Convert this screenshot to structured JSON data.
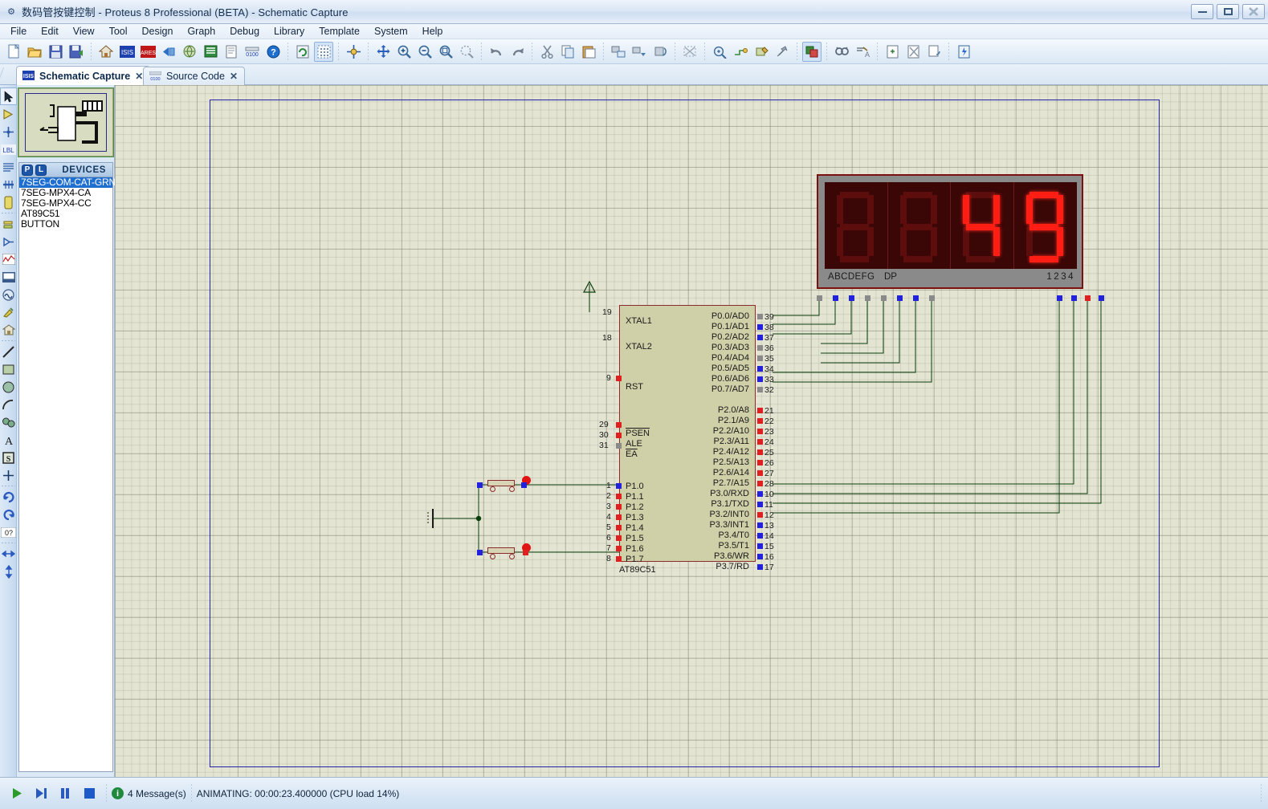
{
  "window": {
    "title": "数码管按键控制 - Proteus 8 Professional (BETA) - Schematic Capture",
    "minimize_label": "—",
    "maximize_label": "❐",
    "close_label": "✕",
    "sysicon_name": "proteus-app-icon"
  },
  "menu": {
    "items": [
      {
        "label": "File"
      },
      {
        "label": "Edit"
      },
      {
        "label": "View"
      },
      {
        "label": "Tool"
      },
      {
        "label": "Design"
      },
      {
        "label": "Graph"
      },
      {
        "label": "Debug"
      },
      {
        "label": "Library"
      },
      {
        "label": "Template"
      },
      {
        "label": "System"
      },
      {
        "label": "Help"
      }
    ]
  },
  "toolbar": {
    "groups": [
      [
        "new-icon",
        "open-icon",
        "save-icon",
        "save-as-icon"
      ],
      [
        "home-icon",
        "isis-icon",
        "ares-icon",
        "back-icon",
        "3d-view-icon",
        "bom-icon",
        "report-icon",
        "source-code-icon",
        "help-icon"
      ],
      [
        "refresh-icon",
        "grid-toggle-icon"
      ],
      [
        "origin-icon"
      ],
      [
        "pan-icon",
        "zoom-in-icon",
        "zoom-out-icon",
        "zoom-all-icon",
        "zoom-area-icon"
      ],
      [
        "undo-icon",
        "redo-icon"
      ],
      [
        "cut-icon",
        "copy-icon",
        "paste-icon"
      ],
      [
        "block-copy-icon",
        "block-move-icon",
        "block-rotate-icon",
        "block-delete-icon"
      ],
      [
        "pick-device-icon",
        "make-device-icon",
        "packaging-tool-icon",
        "decompose-icon"
      ],
      [
        "wire-autorouter-icon"
      ],
      [
        "search-tag-icon",
        "property-assign-icon"
      ],
      [
        "new-sheet-icon",
        "remove-sheet-icon",
        "exit-sheet-icon"
      ],
      [
        "bill-icon"
      ]
    ]
  },
  "tabs": [
    {
      "label": "Schematic Capture",
      "icon": "isis-tab-icon",
      "active": true,
      "close": "✕"
    },
    {
      "label": "Source Code",
      "icon": "code-tab-icon",
      "active": false,
      "close": "✕"
    }
  ],
  "left_toolbar": {
    "tools": [
      {
        "name": "selection-mode-icon",
        "glyph": "➤",
        "selected": true
      },
      {
        "name": "component-mode-icon",
        "glyph": "▷"
      },
      {
        "name": "junction-dot-mode-icon",
        "glyph": "✛"
      },
      {
        "name": "wire-label-mode-icon",
        "glyph": "LBL"
      },
      {
        "name": "text-script-mode-icon",
        "glyph": "≡"
      },
      {
        "name": "bus-mode-icon",
        "glyph": "╫"
      },
      {
        "name": "subcircuit-mode-icon",
        "glyph": "▯"
      },
      {
        "name": "terminals-mode-icon",
        "glyph": "⊐"
      },
      {
        "name": "device-pin-mode-icon",
        "glyph": "⇒"
      },
      {
        "name": "graph-mode-icon",
        "glyph": "📈"
      },
      {
        "name": "tape-recorder-mode-icon",
        "glyph": "▭"
      },
      {
        "name": "generator-mode-icon",
        "glyph": "∿"
      },
      {
        "name": "voltage-probe-mode-icon",
        "glyph": "✒"
      },
      {
        "name": "virtual-instrument-mode-icon",
        "glyph": "🏠"
      },
      {
        "name": "line-tool-icon",
        "glyph": "╱"
      },
      {
        "name": "box-tool-icon",
        "glyph": "▢"
      },
      {
        "name": "circle-tool-icon",
        "glyph": "●"
      },
      {
        "name": "arc-tool-icon",
        "glyph": "◠"
      },
      {
        "name": "path-tool-icon",
        "glyph": "❧"
      },
      {
        "name": "text-tool-icon",
        "glyph": "A"
      },
      {
        "name": "symbol-tool-icon",
        "glyph": "S"
      },
      {
        "name": "marker-tool-icon",
        "glyph": "✛"
      },
      {
        "name": "rotate-clockwise-icon",
        "glyph": "↻"
      },
      {
        "name": "rotate-anticlockwise-icon",
        "glyph": "↺"
      },
      {
        "name": "rotation-angle-field",
        "glyph": "0?"
      },
      {
        "name": "mirror-horizontal-icon",
        "glyph": "↔"
      },
      {
        "name": "mirror-vertical-icon",
        "glyph": "↕"
      }
    ]
  },
  "devices_panel": {
    "header": "DEVICES",
    "pick_button": "P",
    "library_button": "L",
    "items": [
      {
        "label": "7SEG-COM-CAT-GRN",
        "selected": true
      },
      {
        "label": "7SEG-MPX4-CA",
        "selected": false
      },
      {
        "label": "7SEG-MPX4-CC",
        "selected": false
      },
      {
        "label": "AT89C51",
        "selected": false
      },
      {
        "label": "BUTTON",
        "selected": false
      }
    ]
  },
  "schematic": {
    "mcu": {
      "part_name": "AT89C51",
      "left_pins": [
        {
          "num": "19",
          "label": "XTAL1"
        },
        {
          "num": "18",
          "label": "XTAL2"
        },
        {
          "num": "9",
          "label": "RST"
        },
        {
          "num": "29",
          "label": "PSEN"
        },
        {
          "num": "30",
          "label": "ALE"
        },
        {
          "num": "31",
          "label": "EA"
        },
        {
          "num": "1",
          "label": "P1.0"
        },
        {
          "num": "2",
          "label": "P1.1"
        },
        {
          "num": "3",
          "label": "P1.2"
        },
        {
          "num": "4",
          "label": "P1.3"
        },
        {
          "num": "5",
          "label": "P1.4"
        },
        {
          "num": "6",
          "label": "P1.5"
        },
        {
          "num": "7",
          "label": "P1.6"
        },
        {
          "num": "8",
          "label": "P1.7"
        }
      ],
      "right_pins": [
        {
          "num": "39",
          "label": "P0.0/AD0"
        },
        {
          "num": "38",
          "label": "P0.1/AD1"
        },
        {
          "num": "37",
          "label": "P0.2/AD2"
        },
        {
          "num": "36",
          "label": "P0.3/AD3"
        },
        {
          "num": "35",
          "label": "P0.4/AD4"
        },
        {
          "num": "34",
          "label": "P0.5/AD5"
        },
        {
          "num": "33",
          "label": "P0.6/AD6"
        },
        {
          "num": "32",
          "label": "P0.7/AD7"
        },
        {
          "num": "21",
          "label": "P2.0/A8"
        },
        {
          "num": "22",
          "label": "P2.1/A9"
        },
        {
          "num": "23",
          "label": "P2.2/A10"
        },
        {
          "num": "24",
          "label": "P2.3/A11"
        },
        {
          "num": "25",
          "label": "P2.4/A12"
        },
        {
          "num": "26",
          "label": "P2.5/A13"
        },
        {
          "num": "27",
          "label": "P2.6/A14"
        },
        {
          "num": "28",
          "label": "P2.7/A15"
        },
        {
          "num": "10",
          "label": "P3.0/RXD"
        },
        {
          "num": "11",
          "label": "P3.1/TXD"
        },
        {
          "num": "12",
          "label": "P3.2/INT0"
        },
        {
          "num": "13",
          "label": "P3.3/INT1"
        },
        {
          "num": "14",
          "label": "P3.4/T0"
        },
        {
          "num": "15",
          "label": "P3.5/T1"
        },
        {
          "num": "16",
          "label": "P3.6/WR"
        },
        {
          "num": "17",
          "label": "P3.7/RD"
        }
      ]
    },
    "display": {
      "part_type": "7SEG-MPX4-CC",
      "segment_label": "ABCDEFG",
      "dp_label": "DP",
      "digit_label": "1234",
      "digits": [
        {
          "value": "",
          "segments": {
            "a": false,
            "b": false,
            "c": false,
            "d": false,
            "e": false,
            "f": false,
            "g": false
          }
        },
        {
          "value": "",
          "segments": {
            "a": false,
            "b": false,
            "c": false,
            "d": false,
            "e": false,
            "f": false,
            "g": false
          }
        },
        {
          "value": "4",
          "segments": {
            "a": false,
            "b": true,
            "c": true,
            "d": false,
            "e": false,
            "f": true,
            "g": true
          }
        },
        {
          "value": "9",
          "segments": {
            "a": true,
            "b": true,
            "c": true,
            "d": true,
            "e": false,
            "f": true,
            "g": true
          }
        }
      ],
      "displayed_value": "49"
    },
    "colors": {
      "sheet_border": "#2222a8",
      "wire": "#0a3d0a",
      "mcu_body": "#cfcfa8",
      "mcu_outline": "#8c2b2b",
      "display_bezel": "#8a8a8a",
      "segment_on": "#ff1d14",
      "segment_off": "#5e0d0d",
      "pin_high": "#2222dd",
      "pin_low": "#e02020",
      "pin_float": "#8a8a8a",
      "grid_bg": "#e4e4d2"
    }
  },
  "statusbar": {
    "play_label": "▶",
    "step_label": "▶|",
    "pause_label": "❚❚",
    "stop_label": "■",
    "messages": "4 Message(s)",
    "info_glyph": "i",
    "animation_status": "ANIMATING: 00:00:23.400000 (CPU load 14%)"
  }
}
